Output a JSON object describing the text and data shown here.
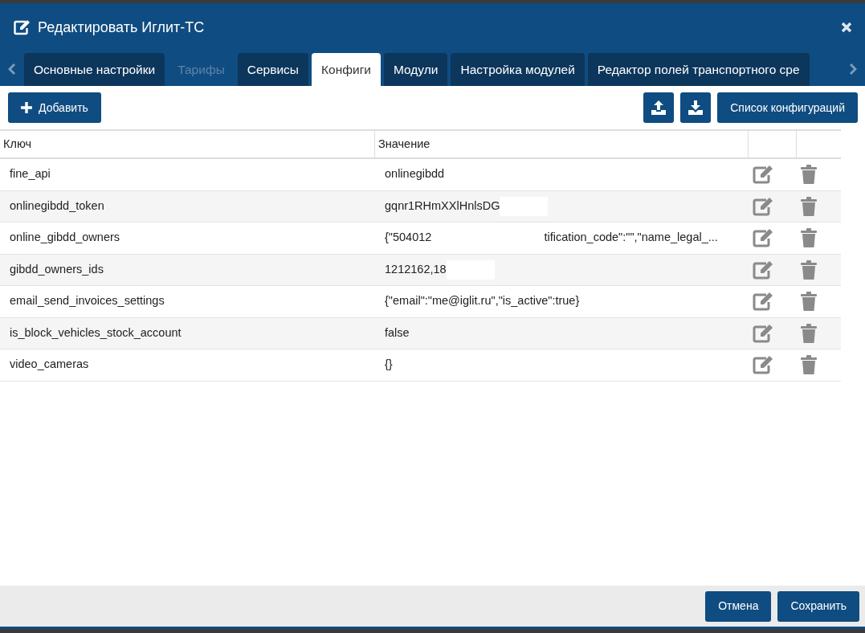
{
  "window": {
    "title": "Редактировать Иглит-ТС"
  },
  "tabs": [
    {
      "label": "Основные настройки",
      "selected": false,
      "disabled": false
    },
    {
      "label": "Тарифы",
      "selected": false,
      "disabled": true
    },
    {
      "label": "Сервисы",
      "selected": false,
      "disabled": false
    },
    {
      "label": "Конфиги",
      "selected": true,
      "disabled": false
    },
    {
      "label": "Модули",
      "selected": false,
      "disabled": false
    },
    {
      "label": "Настройка модулей",
      "selected": false,
      "disabled": false
    },
    {
      "label": "Редактор полей транспортного сре",
      "selected": false,
      "disabled": false
    }
  ],
  "toolbar": {
    "add_button": "Добавить",
    "list_button": "Список конфигураций"
  },
  "table": {
    "columns": [
      "Ключ",
      "Значение"
    ],
    "rows": [
      {
        "key": "fine_api",
        "value": [
          "onlinegibdd"
        ]
      },
      {
        "key": "onlinegibdd_token",
        "value": [
          "gqnr1RHmXXlHnlsDG"
        ],
        "redacted": true
      },
      {
        "key": "online_gibdd_owners",
        "value": [
          "{\"504012",
          "tification_code\":\"\",\"name_legal_..."
        ]
      },
      {
        "key": "gibdd_owners_ids",
        "value": [
          "1212162,18"
        ],
        "redacted": true
      },
      {
        "key": "email_send_invoices_settings",
        "value": [
          "{\"email\":\"me@iglit.ru\",\"is_active\":true}"
        ]
      },
      {
        "key": "is_block_vehicles_stock_account",
        "value": [
          "false"
        ]
      },
      {
        "key": "video_cameras",
        "value": [
          "{}"
        ]
      }
    ]
  },
  "footer": {
    "buttons": [
      "Отмена",
      "Сохранить"
    ]
  }
}
